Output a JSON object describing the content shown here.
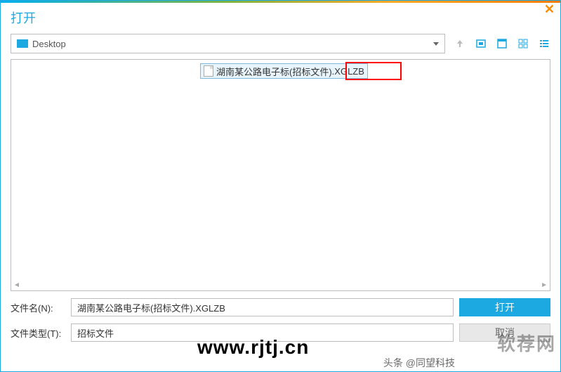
{
  "dialog": {
    "title": "打开"
  },
  "path": {
    "location": "Desktop"
  },
  "files": {
    "items": [
      {
        "name_part1": "湖南某公路电子标(招标文件)",
        "name_part2": ".XGLZB",
        "full": "湖南某公路电子标(招标文件).XGLZB"
      }
    ]
  },
  "fields": {
    "filename_label": "文件名(N):",
    "filename_value": "湖南某公路电子标(招标文件).XGLZB",
    "filetype_label": "文件类型(T):",
    "filetype_value": "招标文件"
  },
  "buttons": {
    "open": "打开",
    "cancel": "取消"
  },
  "watermarks": {
    "url": "www.rjtj.cn",
    "brand": "软荐网",
    "attribution": "头条 @同望科技"
  }
}
